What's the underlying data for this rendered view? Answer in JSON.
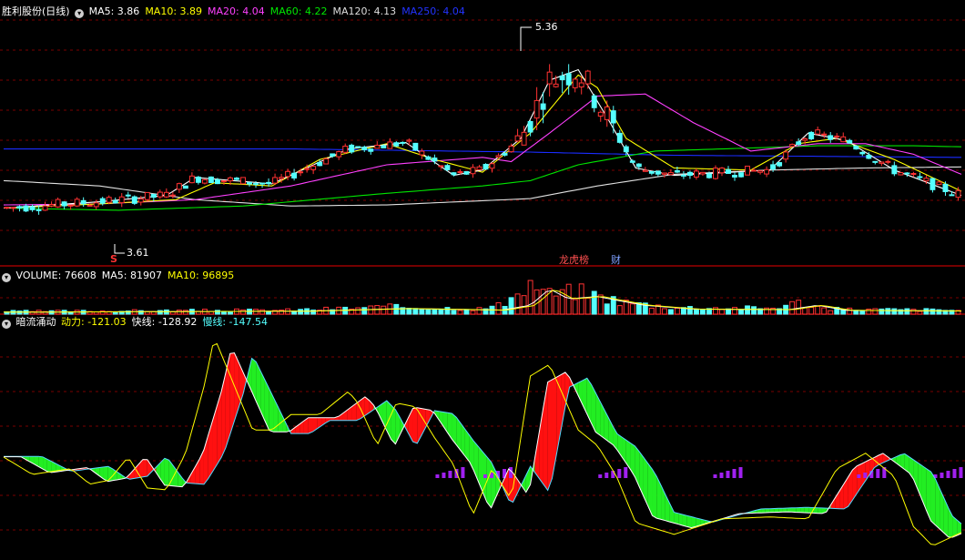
{
  "stock_title": "胜利股份(日线)",
  "colors": {
    "bg": "#000000",
    "grid": "#7a0000",
    "divider": "#9a0000",
    "up": "#ff3232",
    "down": "#54ffff",
    "white": "#ffffff",
    "yellow": "#ffff00",
    "magenta": "#ff40ff",
    "green": "#00e600",
    "blue": "#0a1aff",
    "purple": "#a020f0"
  },
  "legend_price": [
    {
      "label": "MA5:",
      "value": "3.86",
      "color": "#ffffff"
    },
    {
      "label": "MA10:",
      "value": "3.89",
      "color": "#ffff00"
    },
    {
      "label": "MA20:",
      "value": "4.04",
      "color": "#ff40ff"
    },
    {
      "label": "MA60:",
      "value": "4.22",
      "color": "#00e600"
    },
    {
      "label": "MA120:",
      "value": "4.13",
      "color": "#dddddd"
    },
    {
      "label": "MA250:",
      "value": "4.04",
      "color": "#2233ff"
    }
  ],
  "legend_volume": [
    {
      "label": "VOLUME:",
      "value": "76608",
      "color": "#ffffff"
    },
    {
      "label": "MA5:",
      "value": "81907",
      "color": "#ffffff"
    },
    {
      "label": "MA10:",
      "value": "96895",
      "color": "#ffff00"
    }
  ],
  "indicator_name": "暗流涌动",
  "legend_indicator": [
    {
      "label": "动力:",
      "value": "-121.03",
      "color": "#ffff00"
    },
    {
      "label": "快线:",
      "value": "-128.92",
      "color": "#ffffff"
    },
    {
      "label": "慢线:",
      "value": "-147.54",
      "color": "#54ffff"
    }
  ],
  "markers": {
    "high": "5.36",
    "low": "3.61",
    "s_mark": "S",
    "event1": "龙虎榜",
    "event2": "财"
  },
  "chart_data": [
    {
      "type": "candlestick",
      "panel": "price",
      "ylim": [
        3.4,
        5.52
      ],
      "high_label": 5.36,
      "low_label": 3.61,
      "ma_series": [
        {
          "name": "MA250",
          "color": "#1a2cff",
          "points": [
            [
              0,
              4.3
            ],
            [
              0.3,
              4.3
            ],
            [
              0.55,
              4.27
            ],
            [
              0.7,
              4.24
            ],
            [
              1,
              4.22
            ]
          ]
        },
        {
          "name": "MA120",
          "color": "#e0e0e0",
          "points": [
            [
              0,
              4.0
            ],
            [
              0.1,
              3.95
            ],
            [
              0.2,
              3.82
            ],
            [
              0.3,
              3.76
            ],
            [
              0.4,
              3.77
            ],
            [
              0.55,
              3.83
            ],
            [
              0.62,
              3.95
            ],
            [
              0.7,
              4.06
            ],
            [
              0.8,
              4.1
            ],
            [
              0.9,
              4.12
            ],
            [
              1,
              4.13
            ]
          ]
        },
        {
          "name": "MA60",
          "color": "#00e600",
          "points": [
            [
              0,
              3.74
            ],
            [
              0.12,
              3.72
            ],
            [
              0.25,
              3.76
            ],
            [
              0.4,
              3.88
            ],
            [
              0.5,
              3.95
            ],
            [
              0.55,
              4.0
            ],
            [
              0.6,
              4.15
            ],
            [
              0.68,
              4.28
            ],
            [
              0.75,
              4.3
            ],
            [
              0.85,
              4.33
            ],
            [
              0.95,
              4.33
            ],
            [
              1,
              4.32
            ]
          ]
        },
        {
          "name": "MA20",
          "color": "#ff40ff",
          "points": [
            [
              0,
              3.77
            ],
            [
              0.1,
              3.78
            ],
            [
              0.2,
              3.82
            ],
            [
              0.3,
              3.95
            ],
            [
              0.4,
              4.15
            ],
            [
              0.5,
              4.22
            ],
            [
              0.53,
              4.18
            ],
            [
              0.57,
              4.45
            ],
            [
              0.62,
              4.8
            ],
            [
              0.67,
              4.82
            ],
            [
              0.72,
              4.55
            ],
            [
              0.78,
              4.28
            ],
            [
              0.85,
              4.35
            ],
            [
              0.9,
              4.35
            ],
            [
              0.95,
              4.25
            ],
            [
              1,
              4.06
            ]
          ]
        },
        {
          "name": "MA10",
          "color": "#ffff00",
          "points": [
            [
              0,
              3.74
            ],
            [
              0.1,
              3.78
            ],
            [
              0.18,
              3.82
            ],
            [
              0.22,
              3.98
            ],
            [
              0.28,
              3.95
            ],
            [
              0.33,
              4.2
            ],
            [
              0.4,
              4.35
            ],
            [
              0.45,
              4.2
            ],
            [
              0.5,
              4.08
            ],
            [
              0.55,
              4.45
            ],
            [
              0.6,
              5.0
            ],
            [
              0.62,
              4.88
            ],
            [
              0.65,
              4.4
            ],
            [
              0.7,
              4.12
            ],
            [
              0.78,
              4.1
            ],
            [
              0.83,
              4.35
            ],
            [
              0.87,
              4.4
            ],
            [
              0.93,
              4.2
            ],
            [
              1,
              3.9
            ]
          ]
        },
        {
          "name": "MA5",
          "color": "#ffffff",
          "points": [
            [
              0,
              3.74
            ],
            [
              0.1,
              3.8
            ],
            [
              0.17,
              3.86
            ],
            [
              0.2,
              4.03
            ],
            [
              0.28,
              3.97
            ],
            [
              0.36,
              4.3
            ],
            [
              0.42,
              4.36
            ],
            [
              0.47,
              4.05
            ],
            [
              0.5,
              4.1
            ],
            [
              0.54,
              4.4
            ],
            [
              0.57,
              4.95
            ],
            [
              0.6,
              5.05
            ],
            [
              0.63,
              4.6
            ],
            [
              0.66,
              4.12
            ],
            [
              0.7,
              4.05
            ],
            [
              0.8,
              4.1
            ],
            [
              0.84,
              4.45
            ],
            [
              0.88,
              4.38
            ],
            [
              0.93,
              4.1
            ],
            [
              1,
              3.86
            ]
          ]
        }
      ]
    },
    {
      "type": "bar",
      "panel": "volume",
      "ma_series": [
        {
          "name": "MA5",
          "color": "#ffffff"
        },
        {
          "name": "MA10",
          "color": "#ffff00"
        }
      ]
    },
    {
      "type": "line",
      "panel": "indicator",
      "name": "暗流涌动",
      "series_keys": [
        "动力",
        "快线",
        "慢线"
      ],
      "ylim": [
        -260,
        320
      ],
      "anchors": [
        [
          0,
          -10
        ],
        [
          0.03,
          -55
        ],
        [
          0.07,
          -40
        ],
        [
          0.09,
          -80
        ],
        [
          0.11,
          -70
        ],
        [
          0.13,
          -10
        ],
        [
          0.15,
          -90
        ],
        [
          0.17,
          -95
        ],
        [
          0.19,
          0
        ],
        [
          0.21,
          180
        ],
        [
          0.22,
          300
        ],
        [
          0.24,
          180
        ],
        [
          0.26,
          60
        ],
        [
          0.28,
          60
        ],
        [
          0.3,
          100
        ],
        [
          0.33,
          100
        ],
        [
          0.36,
          160
        ],
        [
          0.37,
          130
        ],
        [
          0.39,
          20
        ],
        [
          0.41,
          130
        ],
        [
          0.43,
          120
        ],
        [
          0.45,
          40
        ],
        [
          0.47,
          -30
        ],
        [
          0.49,
          -160
        ],
        [
          0.51,
          -40
        ],
        [
          0.53,
          -120
        ],
        [
          0.55,
          200
        ],
        [
          0.57,
          230
        ],
        [
          0.6,
          60
        ],
        [
          0.62,
          20
        ],
        [
          0.64,
          -60
        ],
        [
          0.66,
          -180
        ],
        [
          0.7,
          -210
        ],
        [
          0.75,
          -170
        ],
        [
          0.8,
          -165
        ],
        [
          0.84,
          -170
        ],
        [
          0.87,
          -40
        ],
        [
          0.9,
          0
        ],
        [
          0.93,
          -60
        ],
        [
          0.95,
          -190
        ],
        [
          0.97,
          -240
        ],
        [
          1,
          -205
        ]
      ],
      "histogram_positions": [
        0.47,
        0.52,
        0.64,
        0.76,
        0.91,
        0.99
      ]
    }
  ]
}
